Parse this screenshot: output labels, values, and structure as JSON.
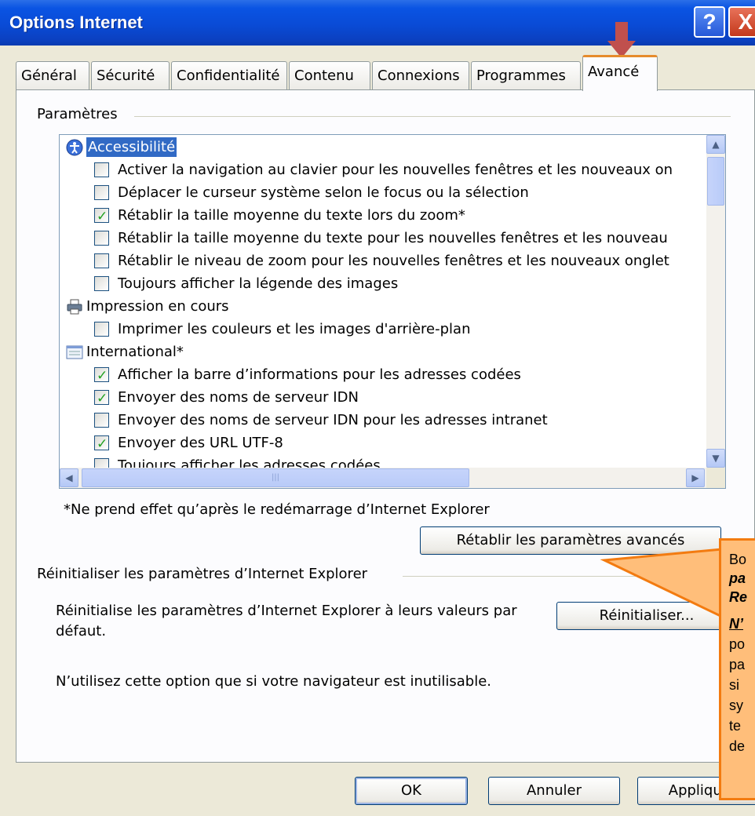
{
  "window": {
    "title": "Options Internet",
    "help_glyph": "?",
    "close_glyph": "X"
  },
  "tabs": [
    {
      "label": "Général"
    },
    {
      "label": "Sécurité"
    },
    {
      "label": "Confidentialité"
    },
    {
      "label": "Contenu"
    },
    {
      "label": "Connexions"
    },
    {
      "label": "Programmes"
    },
    {
      "label": "Avancé",
      "active": true
    }
  ],
  "settings": {
    "group_label": "Paramètres",
    "rows": [
      {
        "type": "category",
        "icon": "accessibility-icon",
        "label": "Accessibilité",
        "selected": true
      },
      {
        "type": "option",
        "checked": false,
        "label": "Activer la navigation au clavier pour les nouvelles fenêtres et les nouveaux on"
      },
      {
        "type": "option",
        "checked": false,
        "label": "Déplacer le curseur système selon le focus ou la sélection"
      },
      {
        "type": "option",
        "checked": true,
        "label": "Rétablir la taille moyenne du texte lors du zoom*"
      },
      {
        "type": "option",
        "checked": false,
        "label": "Rétablir la taille moyenne du texte pour les nouvelles fenêtres et les nouveau"
      },
      {
        "type": "option",
        "checked": false,
        "label": "Rétablir le niveau de zoom pour les nouvelles fenêtres et les nouveaux onglet"
      },
      {
        "type": "option",
        "checked": false,
        "label": "Toujours afficher la légende des images"
      },
      {
        "type": "category",
        "icon": "printer-icon",
        "label": "Impression en cours",
        "selected": false
      },
      {
        "type": "option",
        "checked": false,
        "label": "Imprimer les couleurs et les images d'arrière-plan"
      },
      {
        "type": "category",
        "icon": "international-icon",
        "label": "International*",
        "selected": false
      },
      {
        "type": "option",
        "checked": true,
        "label": "Afficher la barre d’informations pour les adresses codées"
      },
      {
        "type": "option",
        "checked": true,
        "label": "Envoyer des noms de serveur IDN"
      },
      {
        "type": "option",
        "checked": false,
        "label": "Envoyer des noms de serveur IDN pour les adresses intranet"
      },
      {
        "type": "option",
        "checked": true,
        "label": "Envoyer des URL UTF-8"
      },
      {
        "type": "option",
        "checked": false,
        "label": "Toujours afficher les adresses codées"
      }
    ],
    "note": "*Ne prend effet qu’après le redémarrage d’Internet Explorer",
    "restore_button": "Rétablir les paramètres avancés"
  },
  "reset": {
    "group_label": "Réinitialiser les paramètres d’Internet Explorer",
    "description_line1": "Réinitialise les paramètres d’Internet Explorer à leurs valeurs par",
    "description_line2": "défaut.",
    "button": "Réinitialiser...",
    "warning": "N’utilisez cette option que si votre navigateur est inutilisable."
  },
  "footer": {
    "ok": "OK",
    "cancel": "Annuler",
    "apply": "Appliquer"
  },
  "callout": {
    "line1": "Bo",
    "line2": "pa",
    "line3": "Re",
    "line4": "N’",
    "line5": "po",
    "line6": "pa",
    "line7": "si",
    "line8": "sy",
    "line9": "te",
    "line10": "de"
  },
  "colors": {
    "title_bar": "#0a4bd6",
    "selection": "#316ac5",
    "callout_fill": "#ffbe7a",
    "callout_border": "#f37b10",
    "pointer_arrow": "#c0504d",
    "check": "#21a121"
  }
}
